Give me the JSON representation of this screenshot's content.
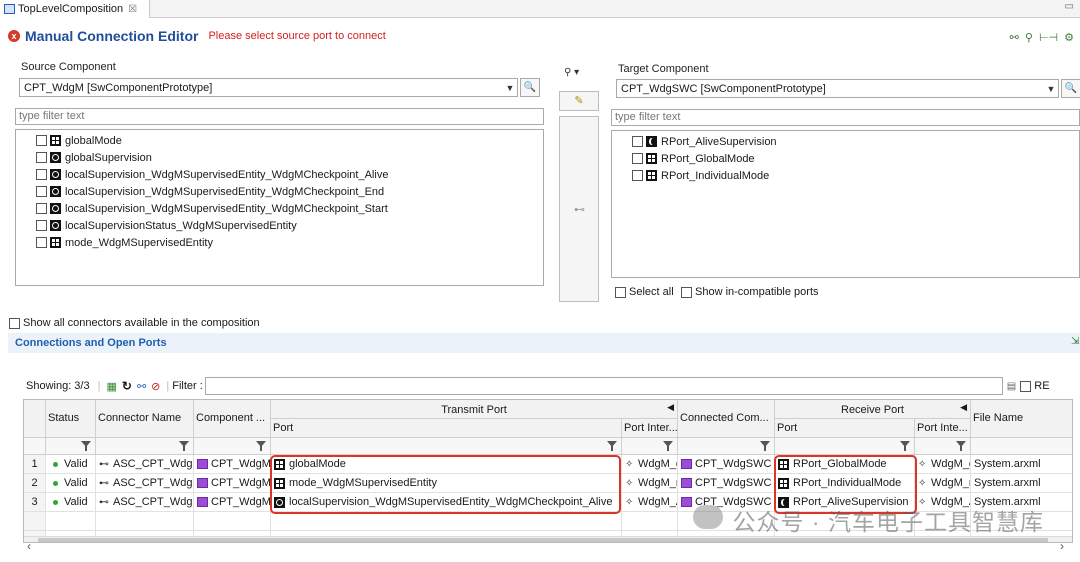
{
  "tab": {
    "title": "TopLevelComposition",
    "close": "☒"
  },
  "window": {
    "minimize": "▭"
  },
  "header": {
    "title": "Manual Connection Editor",
    "status": "Please select source port to connect",
    "tools": [
      "⚯",
      "⚲",
      "⊢⊣",
      "⚙"
    ]
  },
  "source": {
    "label": "Source Component",
    "combo_value": "CPT_WdgM   [SwComponentPrototype]",
    "filter_placeholder": "type filter text",
    "ports": [
      {
        "label": "globalMode",
        "icon": "mode-port-icon"
      },
      {
        "label": "globalSupervision",
        "icon": "sender-receiver-port-icon"
      },
      {
        "label": "localSupervision_WdgMSupervisedEntity_WdgMCheckpoint_Alive",
        "icon": "sender-receiver-port-icon"
      },
      {
        "label": "localSupervision_WdgMSupervisedEntity_WdgMCheckpoint_End",
        "icon": "sender-receiver-port-icon"
      },
      {
        "label": "localSupervision_WdgMSupervisedEntity_WdgMCheckpoint_Start",
        "icon": "sender-receiver-port-icon"
      },
      {
        "label": "localSupervisionStatus_WdgMSupervisedEntity",
        "icon": "sender-receiver-port-icon"
      },
      {
        "label": "mode_WdgMSupervisedEntity",
        "icon": "mode-port-icon"
      }
    ]
  },
  "middle": {
    "filter_icon": "⚲ ▾",
    "connect_glyph": "⊷"
  },
  "target": {
    "label": "Target Component",
    "combo_value": "CPT_WdgSWC   [SwComponentPrototype]",
    "filter_placeholder": "type filter text",
    "ports": [
      {
        "label": "RPort_AliveSupervision",
        "icon": "client-server-port-icon"
      },
      {
        "label": "RPort_GlobalMode",
        "icon": "mode-port-icon"
      },
      {
        "label": "RPort_IndividualMode",
        "icon": "mode-port-icon"
      }
    ],
    "select_all": "Select all",
    "show_incompatible": "Show in-compatible ports"
  },
  "show_all_connectors": "Show all connectors available in the composition",
  "connections": {
    "title": "Connections and Open Ports",
    "showing": "Showing: 3/3",
    "filter_label": "Filter :",
    "regex_label": "RE",
    "columns": {
      "status": "Status",
      "connector_name": "Connector Name",
      "component": "Component ...",
      "transmit_group": "Transmit Port",
      "transmit_port": "Port",
      "transmit_pi": "Port Inter...",
      "connected_component": "Connected Com...",
      "receive_group": "Receive Port",
      "receive_port": "Port",
      "receive_pi": "Port Inte...",
      "file_name": "File Name"
    },
    "rows": [
      {
        "num": "1",
        "status": "Valid",
        "connector": "ASC_CPT_WdgM_globalMode",
        "component": "CPT_WdgM",
        "tx_port": "globalMode",
        "tx_icon": "mode-port-icon",
        "tx_pi": "WdgM_globalMode",
        "connected": "CPT_WdgSWC",
        "rx_port": "RPort_GlobalMode",
        "rx_icon": "mode-port-icon",
        "rx_pi": "WdgM_globalMode",
        "file": "System.arxml"
      },
      {
        "num": "2",
        "status": "Valid",
        "connector": "ASC_CPT_WdgM_mode",
        "component": "CPT_WdgM",
        "tx_port": "mode_WdgMSupervisedEntity",
        "tx_icon": "mode-port-icon",
        "tx_pi": "WdgM_mode",
        "connected": "CPT_WdgSWC",
        "rx_port": "RPort_IndividualMode",
        "rx_icon": "mode-port-icon",
        "rx_pi": "WdgM_mode",
        "file": "System.arxml"
      },
      {
        "num": "3",
        "status": "Valid",
        "connector": "ASC_CPT_WdgM_localSupervision",
        "component": "CPT_WdgM",
        "tx_port": "localSupervision_WdgMSupervisedEntity_WdgMCheckpoint_Alive",
        "tx_icon": "sender-receiver-port-icon",
        "tx_pi": "WdgM_AliveSupervision",
        "connected": "CPT_WdgSWC",
        "rx_port": "RPort_AliveSupervision",
        "rx_icon": "client-server-port-icon",
        "rx_pi": "WdgM_AliveSupervision",
        "file": "System.arxml"
      }
    ]
  },
  "watermark": "公众号 · 汽车电子工具智慧库",
  "colors": {
    "title": "#1f4e9a",
    "error": "#d42020",
    "highlight": "#d9352b",
    "section": "#1f5eb0"
  }
}
